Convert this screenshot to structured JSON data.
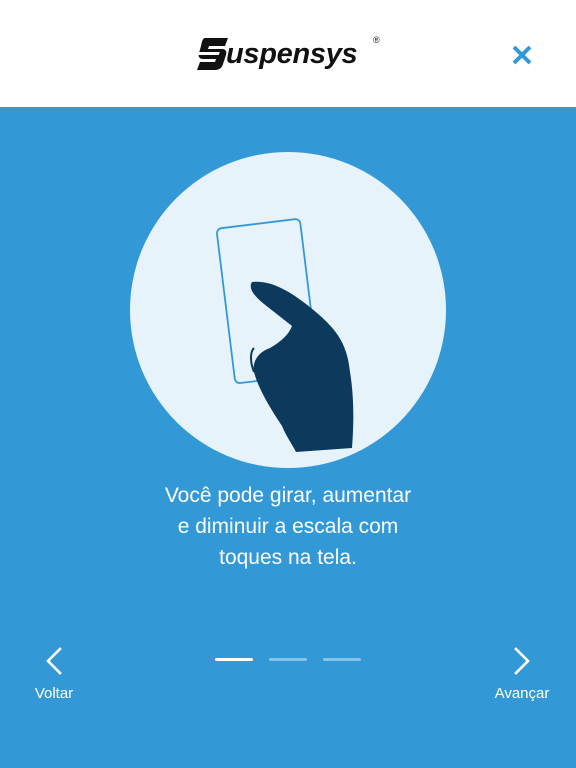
{
  "header": {
    "brand_name": "uspensys",
    "brand_full": "Suspensys",
    "brand_mark": "®",
    "close_icon": "close-icon"
  },
  "tutorial": {
    "illustration_icon": "hand-touch-card-icon",
    "message_lines": [
      "Você pode girar, aumentar",
      "e diminuir a escala com",
      "toques na tela."
    ]
  },
  "navigation": {
    "back_label": "Voltar",
    "back_icon": "chevron-left-icon",
    "next_label": "Avançar",
    "next_icon": "chevron-right-icon"
  },
  "pager": {
    "total": 3,
    "current": 1
  },
  "colors": {
    "background": "#3399d6",
    "header": "#ffffff",
    "circle": "#e6f3fb",
    "hand": "#0d3a5c",
    "card_outline": "#3399d6",
    "accent": "#3399d6",
    "dot_inactive": "#86c3ea"
  }
}
